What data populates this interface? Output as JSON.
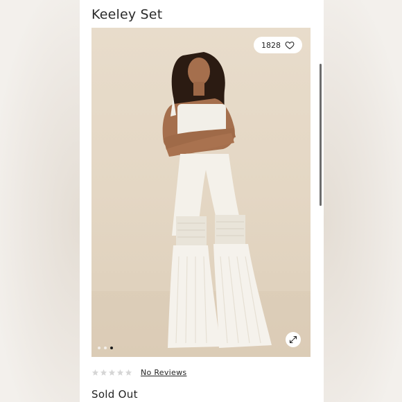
{
  "product": {
    "title": "Keeley Set",
    "favorite_count": "1828",
    "reviews_label": "No Reviews",
    "rating": 0,
    "rating_max": 5,
    "status": "Sold Out"
  },
  "gallery": {
    "image_count": 3,
    "active_index": 2
  },
  "icons": {
    "favorite": "heart-icon",
    "expand": "expand-icon",
    "rating": "star-icon"
  },
  "colors": {
    "star_empty": "#d6d6d6",
    "text": "#222222"
  }
}
